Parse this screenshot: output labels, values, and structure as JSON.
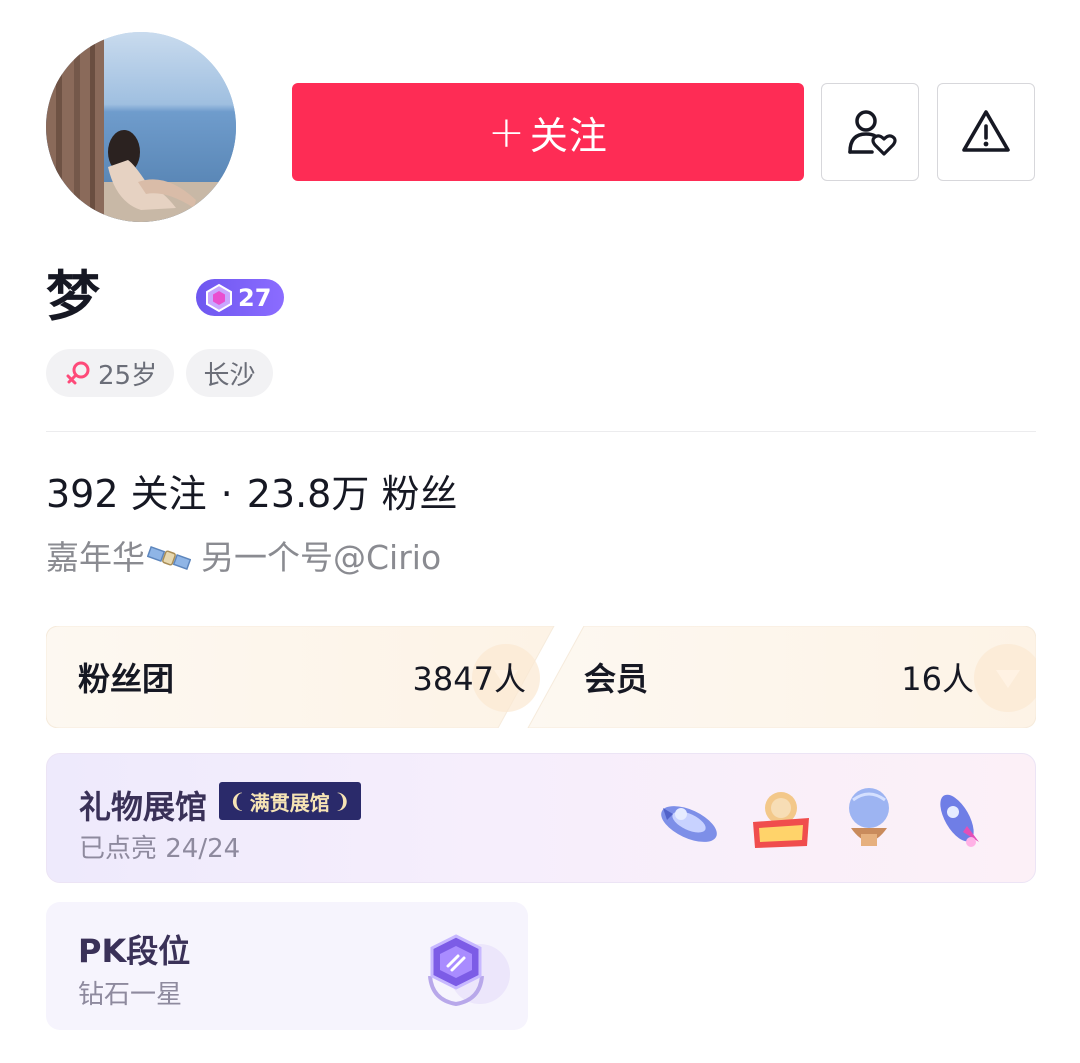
{
  "profile": {
    "name": "梦",
    "level": "27",
    "gender_icon": "female-icon",
    "age": "25岁",
    "location": "长沙"
  },
  "actions": {
    "follow_plus": "+",
    "follow_label": "关注",
    "friend_icon": "person-heart-icon",
    "report_icon": "warning-icon"
  },
  "stats": {
    "following_count": "392",
    "following_label": "关注",
    "separator": "·",
    "followers_count": "23.8万",
    "followers_label": "粉丝"
  },
  "bio": {
    "text_before": "嘉年华",
    "text_after": "另一个号@Cirio",
    "emoji": "satellite-emoji"
  },
  "fan_club": {
    "label": "粉丝团",
    "count": "3847人"
  },
  "membership": {
    "label": "会员",
    "count": "16人"
  },
  "gift_hall": {
    "title": "礼物展馆",
    "badge": "满贯展馆",
    "progress_label": "已点亮 24/24",
    "lit": 24,
    "total": 24
  },
  "pk": {
    "title": "PK段位",
    "rank": "钻石一星"
  },
  "colors": {
    "accent": "#fe2c55",
    "level_badge": "#7a60f5",
    "text_primary": "#161823",
    "text_secondary": "#8a8b91"
  }
}
